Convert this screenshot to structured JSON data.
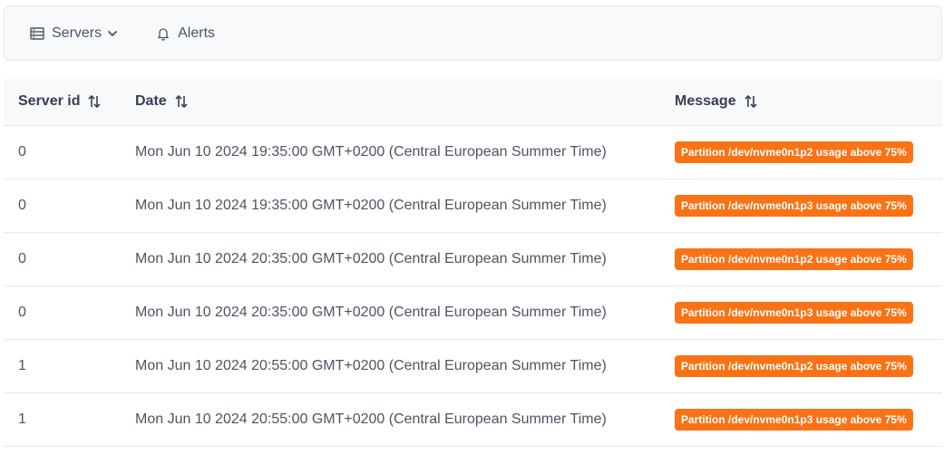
{
  "nav": {
    "servers_label": "Servers",
    "alerts_label": "Alerts"
  },
  "table": {
    "columns": [
      "Server id",
      "Date",
      "Message"
    ],
    "rows": [
      {
        "server_id": "0",
        "date": "Mon Jun 10 2024 19:35:00 GMT+0200 (Central European Summer Time)",
        "message": "Partition /dev/nvme0n1p2 usage above 75%"
      },
      {
        "server_id": "0",
        "date": "Mon Jun 10 2024 19:35:00 GMT+0200 (Central European Summer Time)",
        "message": "Partition /dev/nvme0n1p3 usage above 75%"
      },
      {
        "server_id": "0",
        "date": "Mon Jun 10 2024 20:35:00 GMT+0200 (Central European Summer Time)",
        "message": "Partition /dev/nvme0n1p2 usage above 75%"
      },
      {
        "server_id": "0",
        "date": "Mon Jun 10 2024 20:35:00 GMT+0200 (Central European Summer Time)",
        "message": "Partition /dev/nvme0n1p3 usage above 75%"
      },
      {
        "server_id": "1",
        "date": "Mon Jun 10 2024 20:55:00 GMT+0200 (Central European Summer Time)",
        "message": "Partition /dev/nvme0n1p2 usage above 75%"
      },
      {
        "server_id": "1",
        "date": "Mon Jun 10 2024 20:55:00 GMT+0200 (Central European Summer Time)",
        "message": "Partition /dev/nvme0n1p3 usage above 75%"
      }
    ]
  },
  "colors": {
    "badge_warning": "#f97316",
    "header_bg": "#f8f9fa"
  },
  "icons": {
    "servers": "server-icon",
    "dropdown": "chevron-down-icon",
    "alerts": "bell-icon",
    "sort": "sort-icon"
  }
}
